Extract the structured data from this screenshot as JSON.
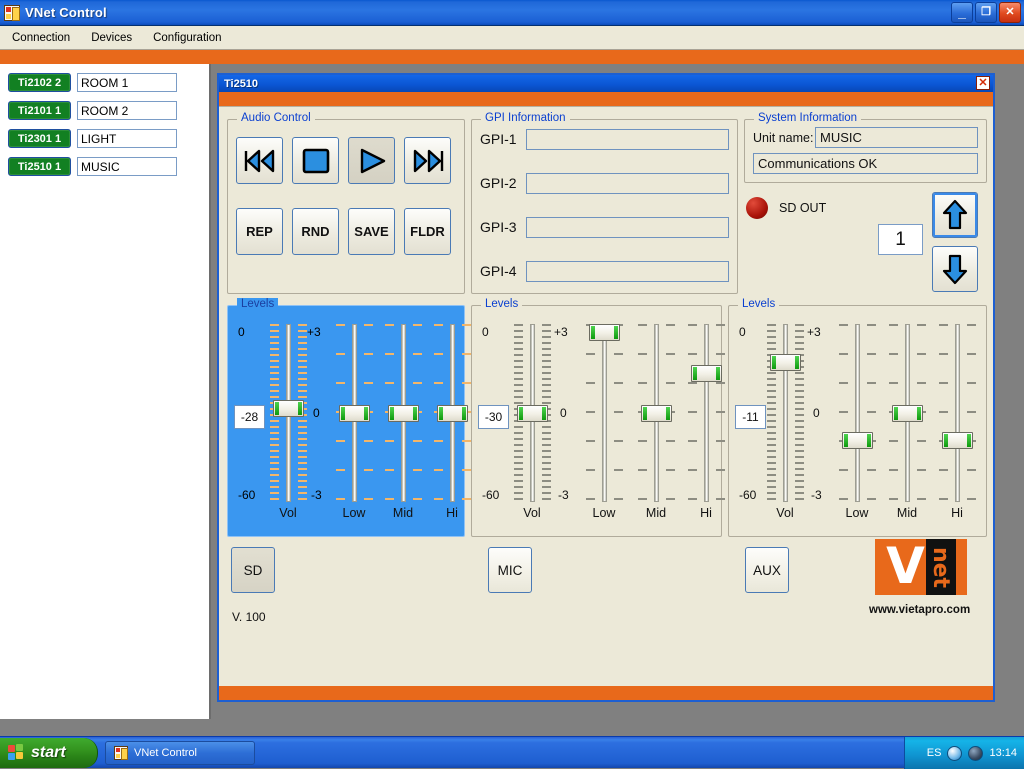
{
  "window": {
    "title": "VNet Control",
    "icon": "app-window-icon",
    "buttons": {
      "minimize": "_",
      "restore": "❐",
      "close": "✕"
    }
  },
  "menu": {
    "items": [
      "Connection",
      "Devices",
      "Configuration"
    ]
  },
  "devices": [
    {
      "id": "Ti2102 2",
      "name": "ROOM 1"
    },
    {
      "id": "Ti2101 1",
      "name": "ROOM 2"
    },
    {
      "id": "Ti2301 1",
      "name": "LIGHT"
    },
    {
      "id": "Ti2510 1",
      "name": "MUSIC"
    }
  ],
  "child_window": {
    "title": "Ti2510",
    "close_label": "✕"
  },
  "audio_control": {
    "legend": "Audio Control",
    "transport": [
      {
        "name": "previous-track",
        "glyph": "prev-icon",
        "pressed": false
      },
      {
        "name": "stop",
        "glyph": "stop-icon",
        "pressed": false
      },
      {
        "name": "play",
        "glyph": "play-icon",
        "pressed": true
      },
      {
        "name": "next-track",
        "glyph": "next-icon",
        "pressed": false
      }
    ],
    "mode_buttons": [
      "REP",
      "RND",
      "SAVE",
      "FLDR"
    ]
  },
  "gpi": {
    "legend": "GPI Information",
    "rows": [
      {
        "label": "GPI-1",
        "value": ""
      },
      {
        "label": "GPI-2",
        "value": ""
      },
      {
        "label": "GPI-3",
        "value": ""
      },
      {
        "label": "GPI-4",
        "value": ""
      }
    ]
  },
  "system": {
    "legend": "System Information",
    "unit_name_label": "Unit name:",
    "unit_name_value": "MUSIC",
    "status": "Communications OK",
    "sd_out_label": "SD OUT",
    "sd_led_color": "#a81208",
    "track_number": "1",
    "up_label": "↑",
    "down_label": "↓"
  },
  "levels": [
    {
      "legend": "Levels",
      "selected": true,
      "vol_top": "0",
      "vol_bottom": "-60",
      "eq_top": "+3",
      "eq_mid": "0",
      "eq_bottom": "-3",
      "vol_value": "-28",
      "sliders": [
        {
          "label": "Vol",
          "value": -28,
          "min": -60,
          "max": 0,
          "ticks": 30
        },
        {
          "label": "Low",
          "value": 0,
          "min": -3,
          "max": 3,
          "ticks": 7
        },
        {
          "label": "Mid",
          "value": 0,
          "min": -3,
          "max": 3,
          "ticks": 7
        },
        {
          "label": "Hi",
          "value": 0,
          "min": -3,
          "max": 3,
          "ticks": 7
        }
      ]
    },
    {
      "legend": "Levels",
      "selected": false,
      "vol_top": "0",
      "vol_bottom": "-60",
      "eq_top": "+3",
      "eq_mid": "0",
      "eq_bottom": "-3",
      "vol_value": "-30",
      "sliders": [
        {
          "label": "Vol",
          "value": -30,
          "min": -60,
          "max": 0,
          "ticks": 30
        },
        {
          "label": "Low",
          "value": 3,
          "min": -3,
          "max": 3,
          "ticks": 7
        },
        {
          "label": "Mid",
          "value": 0,
          "min": -3,
          "max": 3,
          "ticks": 7
        },
        {
          "label": "Hi",
          "value": 1.5,
          "min": -3,
          "max": 3,
          "ticks": 7
        }
      ]
    },
    {
      "legend": "Levels",
      "selected": false,
      "vol_top": "0",
      "vol_bottom": "-60",
      "eq_top": "+3",
      "eq_mid": "0",
      "eq_bottom": "-3",
      "vol_value": "-11",
      "sliders": [
        {
          "label": "Vol",
          "value": -11,
          "min": -60,
          "max": 0,
          "ticks": 30
        },
        {
          "label": "Low",
          "value": -1,
          "min": -3,
          "max": 3,
          "ticks": 7
        },
        {
          "label": "Mid",
          "value": 0,
          "min": -3,
          "max": 3,
          "ticks": 7
        },
        {
          "label": "Hi",
          "value": -1,
          "min": -3,
          "max": 3,
          "ticks": 7
        }
      ]
    }
  ],
  "sources": [
    {
      "label": "SD",
      "active": true
    },
    {
      "label": "MIC",
      "active": false
    },
    {
      "label": "AUX",
      "active": false
    }
  ],
  "footer": {
    "version": "V. 100",
    "logo_letter": "V",
    "logo_word": "net",
    "url": "www.vietapro.com",
    "brand_color": "#e8691b"
  },
  "taskbar": {
    "start_label": "start",
    "task_label": "VNet Control",
    "tray_language": "ES",
    "clock": "13:14"
  }
}
